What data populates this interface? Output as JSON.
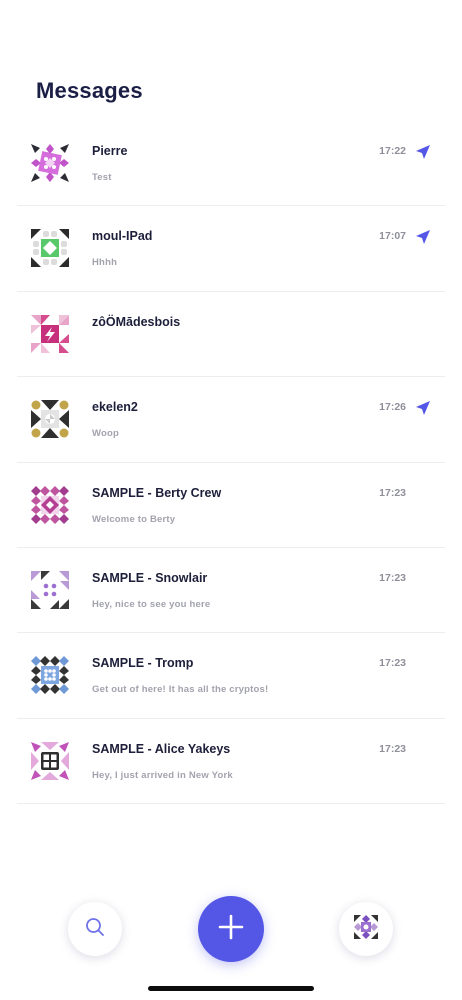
{
  "header": {
    "title": "Messages"
  },
  "accent_color": "#5457e6",
  "conversations": [
    {
      "name": "Pierre",
      "preview": "Test",
      "time": "17:22",
      "sent": true,
      "avatar": "pierre-avatar-icon"
    },
    {
      "name": "moul-IPad",
      "preview": "Hhhh",
      "time": "17:07",
      "sent": true,
      "avatar": "moul-ipad-avatar-icon"
    },
    {
      "name": "zôÖMādesbois",
      "preview": "",
      "time": "",
      "sent": false,
      "avatar": "zoomadesbois-avatar-icon"
    },
    {
      "name": "ekelen2",
      "preview": "Woop",
      "time": "17:26",
      "sent": true,
      "avatar": "ekelen2-avatar-icon"
    },
    {
      "name": "SAMPLE - Berty Crew",
      "preview": "Welcome to Berty",
      "time": "17:23",
      "sent": false,
      "avatar": "berty-crew-avatar-icon"
    },
    {
      "name": "SAMPLE - Snowlair",
      "preview": "Hey, nice to see you here",
      "time": "17:23",
      "sent": false,
      "avatar": "snowlair-avatar-icon"
    },
    {
      "name": "SAMPLE - Tromp",
      "preview": "Get out of here! It has all the cryptos!",
      "time": "17:23",
      "sent": false,
      "avatar": "tromp-avatar-icon"
    },
    {
      "name": "SAMPLE - Alice Yakeys",
      "preview": "Hey, I just arrived in New York",
      "time": "17:23",
      "sent": false,
      "avatar": "alice-yakeys-avatar-icon"
    }
  ],
  "bottom_bar": {
    "left": "search-icon",
    "center": "plus-icon",
    "right": "account-avatar-icon"
  }
}
